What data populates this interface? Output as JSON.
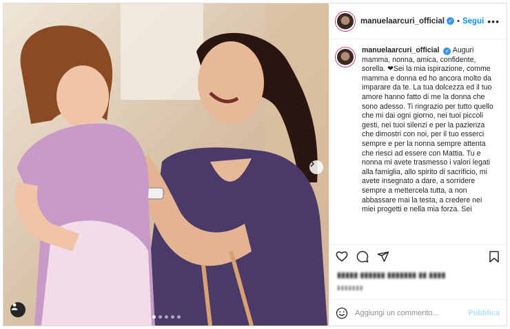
{
  "post": {
    "username": "manuelaarcuri_official",
    "separator": "•",
    "follow_label": "Segui",
    "caption": "Auguri mamma, nonna, amica, confidente, sorella. ❤Sei la mia ispirazione, comme mamma e donna ed ho ancora molto da imparare da te. La tua dolcezza ed il tuo amore hanno fatto di me la donna che sono adesso. Ti ringrazio per tutto quello che mi dai ogni giorno, nei tuoi piccoli gesti, nei tuoi silenzi e per la pazienza che dimostri con noi, per il tuo esserci sempre e per la nonna sempre attenta che riesci ad essere con Mattia. Tu e nonna mi avete trasmesso i valori legati alla famiglia, allo spirito di sacrificio, mi avete insegnato a dare, a sorridere sempre a mettercela tutta, a non abbassare mai la testa, a credere nei miei progetti e nella mia forza. Sei",
    "likes_blurred": "▮▮▮▮▮ ▮▮▮▮▮▮ ▮▮▮▮▮▮▮ ▮▮ ▮▮▮▮",
    "date_blurred": "▮▮▮▮▮▮▮"
  },
  "carousel": {
    "slides": 5,
    "active": 0
  },
  "comment": {
    "placeholder": "Aggiungi un commento...",
    "publish_label": "Pubblica"
  },
  "icons": {
    "more": "more-icon",
    "like": "heart-icon",
    "comment": "comment-icon",
    "share": "share-icon",
    "save": "bookmark-icon",
    "emoji": "emoji-icon",
    "user_tag": "user-tag-icon",
    "next": "chevron-right-icon"
  },
  "colors": {
    "follow_blue": "#0095f6",
    "publish_disabled": "#b2dffc",
    "verified_blue": "#3897f0"
  }
}
